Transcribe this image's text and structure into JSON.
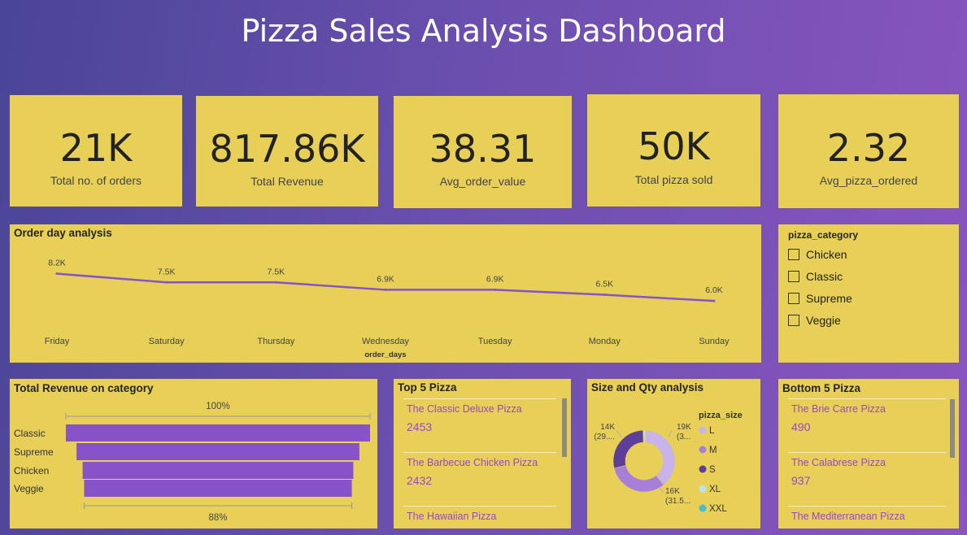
{
  "title": "Pizza Sales Analysis Dashboard",
  "kpis": [
    {
      "value": "21K",
      "label": "Total no. of orders"
    },
    {
      "value": "817.86K",
      "label": "Total Revenue"
    },
    {
      "value": "38.31",
      "label": "Avg_order_value"
    },
    {
      "value": "50K",
      "label": "Total pizza sold"
    },
    {
      "value": "2.32",
      "label": "Avg_pizza_ordered"
    }
  ],
  "slicer": {
    "title": "pizza_category",
    "options": [
      "Chicken",
      "Classic",
      "Supreme",
      "Veggie"
    ]
  },
  "top5": {
    "title": "Top 5 Pizza",
    "items": [
      {
        "name": "The Classic Deluxe Pizza",
        "qty": "2453"
      },
      {
        "name": "The Barbecue Chicken Pizza",
        "qty": "2432"
      },
      {
        "name": "The Hawaiian Pizza",
        "qty": ""
      }
    ]
  },
  "bottom5": {
    "title": "Bottom 5 Pizza",
    "items": [
      {
        "name": "The Brie Carre Pizza",
        "qty": "490"
      },
      {
        "name": "The Calabrese Pizza",
        "qty": "937"
      },
      {
        "name": "The Mediterranean Pizza",
        "qty": ""
      }
    ]
  },
  "colors": {
    "accent": "#8853c8",
    "card": "#e8cf58"
  },
  "chart_data": [
    {
      "type": "line",
      "title": "Order day analysis",
      "xlabel": "order_days",
      "ylabel": "",
      "categories": [
        "Friday",
        "Saturday",
        "Thursday",
        "Wednesday",
        "Tuesday",
        "Monday",
        "Sunday"
      ],
      "values": [
        8200,
        7500,
        7500,
        6900,
        6900,
        6500,
        6000
      ],
      "data_labels": [
        "8.2K",
        "7.5K",
        "7.5K",
        "6.9K",
        "6.9K",
        "6.5K",
        "6.0K"
      ],
      "ylim": [
        3000,
        8500
      ]
    },
    {
      "type": "bar",
      "subtype": "funnel",
      "title": "Total Revenue on category",
      "categories": [
        "Classic",
        "Supreme",
        "Chicken",
        "Veggie"
      ],
      "values": [
        100,
        93,
        89,
        88
      ],
      "top_label": "100%",
      "bottom_label": "88%"
    },
    {
      "type": "pie",
      "subtype": "donut",
      "title": "Size and Qty analysis",
      "legend_title": "pizza_size",
      "legend_position": "right",
      "labels": [
        "L",
        "M",
        "S",
        "XL",
        "XXL"
      ],
      "values": [
        19000,
        16000,
        14000,
        550,
        28
      ],
      "colors": [
        "#c8b3ea",
        "#a77fd9",
        "#5d3e98",
        "#b9e4ec",
        "#45bfcf"
      ],
      "slice_labels": [
        {
          "value": "19K",
          "pct": "(3..."
        },
        {
          "value": "16K",
          "pct": "(31.5..."
        },
        {
          "value": "14K",
          "pct": "(29...."
        }
      ]
    }
  ]
}
